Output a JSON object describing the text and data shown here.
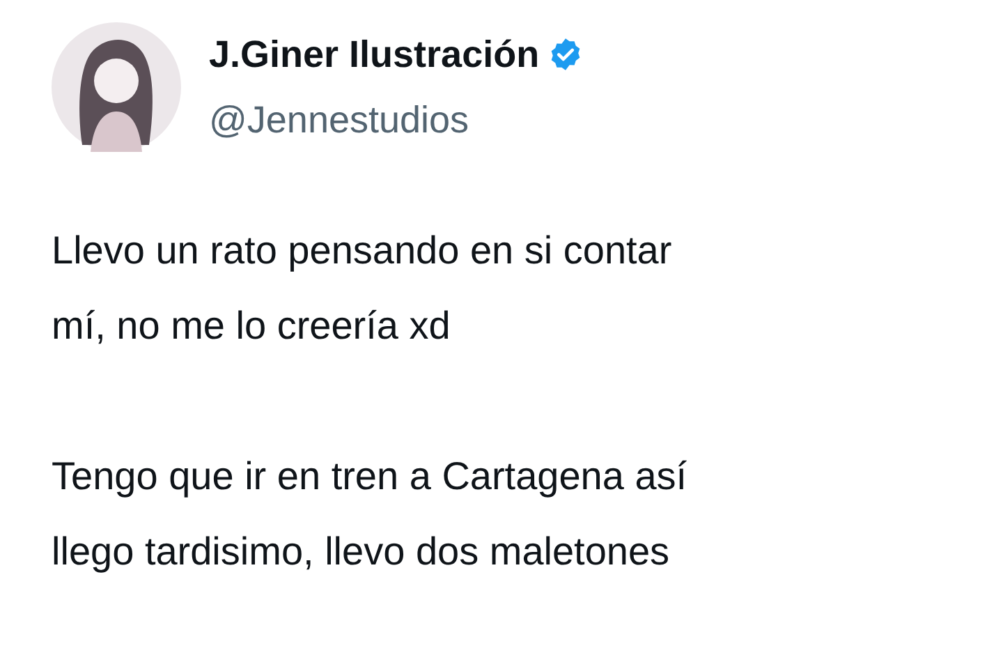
{
  "author": {
    "name": "J.Giner Ilustración",
    "verified": true,
    "handle": "@Jennestudios"
  },
  "paragraphs": [
    {
      "lines": [
        "Llevo un rato pensando en si contar",
        "mí, no me lo creería xd"
      ]
    },
    {
      "lines": [
        "Tengo que ir en tren a Cartagena así",
        "llego tardisimo, llevo dos maletones"
      ]
    }
  ]
}
